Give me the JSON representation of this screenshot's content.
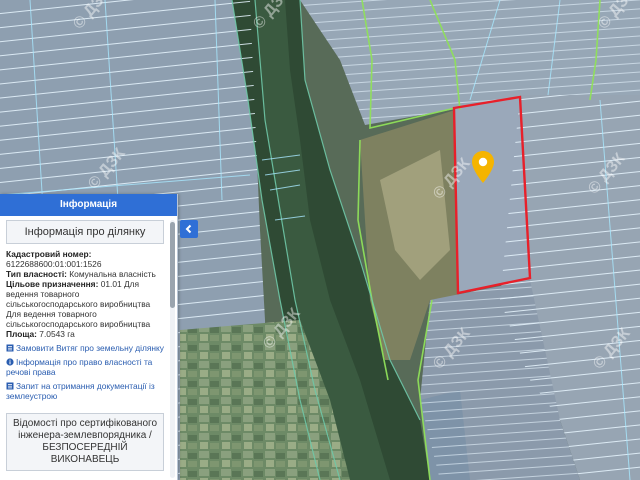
{
  "watermark": "© ДЗК",
  "panel": {
    "header": "Інформація",
    "title": "Інформація про ділянку",
    "cadastral_label": "Кадастровий номер:",
    "cadastral_value": "6122688600:01:001:1526",
    "ownership_label": "Тип власності:",
    "ownership_value": "Комунальна власність",
    "purpose_label": "Цільове призначення:",
    "purpose_value": "01.01 Для ведення товарного сільськогосподарського виробництва Для ведення товарного сільськогосподарського виробництва",
    "area_label": "Площа:",
    "area_value": "7.0543 га",
    "links": [
      {
        "label": "Замовити Витяг про земельну ділянку",
        "icon": "document-icon"
      },
      {
        "label": "Інформація про право власності та речові права",
        "icon": "info-icon"
      },
      {
        "label": "Запит на отримання документації із землеустрою",
        "icon": "document-icon"
      }
    ],
    "bottom_box": "Відомості про сертифікованого інженера-землевпорядника / БЕЗПОСЕРЕДНІЙ ВИКОНАВЕЦЬ"
  },
  "collapse_button": {
    "icon": "chevron-left-icon"
  },
  "colors": {
    "panel_header": "#2f6fd6",
    "selected_parcel": "#e8202a",
    "parcel_outline": "#e6f6ff",
    "boundary": "#8fe05a",
    "marker": "#f5b400"
  }
}
